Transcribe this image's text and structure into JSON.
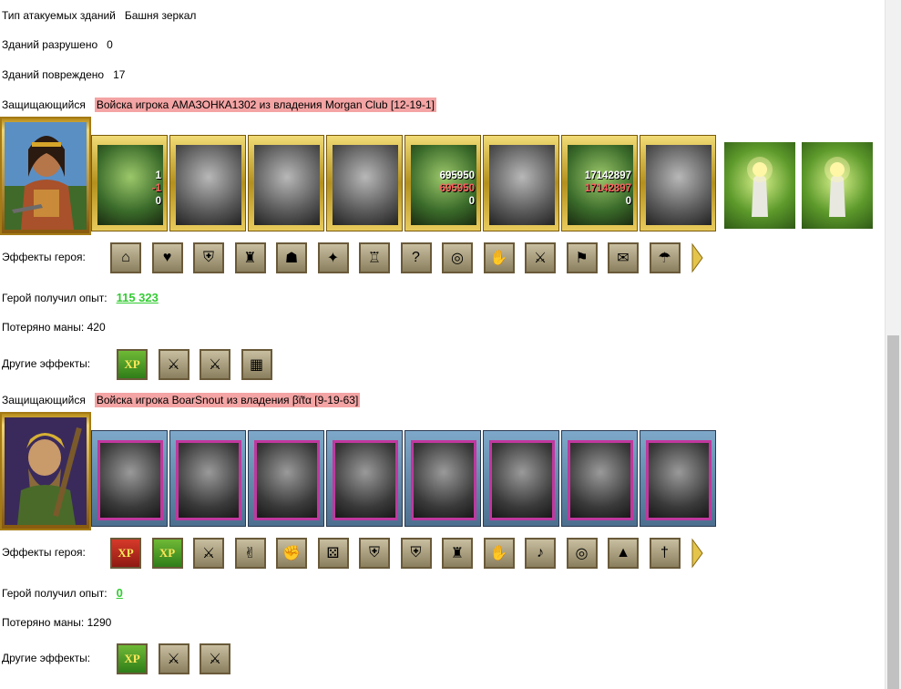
{
  "stats": {
    "building_type_label": "Тип атакуемых зданий",
    "building_type_value": "Башня зеркал",
    "destroyed_label": "Зданий разрушено",
    "destroyed_value": "0",
    "damaged_label": "Зданий повреждено",
    "damaged_value": "17"
  },
  "defender1": {
    "label": "Защищающийся",
    "title": "Войска игрока АМАЗОНКА1302 из владения Morgan Club [12-19-1]",
    "units": [
      {
        "icon": "dwarf-unit-icon",
        "n1": "1",
        "n2": "-1",
        "n3": "0",
        "color": true
      },
      {
        "icon": "dark-knight-unit-icon",
        "color": false
      },
      {
        "icon": "warrior-unit-icon",
        "color": false
      },
      {
        "icon": "griffin-unit-icon",
        "color": false
      },
      {
        "icon": "archer-unit-icon",
        "n1": "695950",
        "n2": "695950",
        "n3": "0",
        "color": true
      },
      {
        "icon": "sorceress-unit-icon",
        "color": false
      },
      {
        "icon": "druid-unit-icon",
        "n1": "17142897",
        "n2": "17142897",
        "n3": "0",
        "color": true
      },
      {
        "icon": "titan-unit-icon",
        "color": false
      }
    ],
    "effects_label": "Эффекты героя:",
    "effects": [
      "house-icon",
      "heart-icon",
      "shield-icon",
      "armor-icon",
      "helmet-icon",
      "amulet-icon",
      "tunic-icon",
      "question-icon",
      "ring-icon",
      "gauntlet-icon",
      "sword-icon",
      "banner-icon",
      "scroll-icon",
      "cloak-icon"
    ],
    "exp_label": "Герой получил опыт:",
    "exp_value": "115 323",
    "mana_label": "Потеряно маны:",
    "mana_value": "420",
    "other_label": "Другие эффекты:",
    "other": [
      "xp-icon",
      "sword-icon",
      "sword-scroll-icon",
      "wall-icon"
    ]
  },
  "defender2": {
    "label": "Защищающийся",
    "title": "Войска игрока BoarSnout из владения βϊ̃τα [9-19-63]",
    "units": [
      {
        "icon": "ghoul-unit-icon"
      },
      {
        "icon": "skeleton-unit-icon"
      },
      {
        "icon": "death-knight-unit-icon"
      },
      {
        "icon": "bone-dragon-unit-icon"
      },
      {
        "icon": "lich-king-unit-icon"
      },
      {
        "icon": "banshee-unit-icon"
      },
      {
        "icon": "reaper-unit-icon"
      },
      {
        "icon": "necromancer-unit-icon"
      }
    ],
    "effects_label": "Эффекты героя:",
    "effects": [
      "xp-icon",
      "group-xp-icon",
      "sword-icon",
      "handshake-icon",
      "fist-icon",
      "dice-icon",
      "shield-icon",
      "handshake-shield-icon",
      "armor-icon",
      "gauntlet-icon",
      "horn-icon",
      "ring-icon",
      "tent-icon",
      "dagger-icon"
    ],
    "exp_label": "Герой получил опыт:",
    "exp_value": "0",
    "mana_label": "Потеряно маны:",
    "mana_value": "1290",
    "other_label": "Другие эффекты:",
    "other": [
      "xp-icon",
      "sword-icon",
      "sword-scroll-icon"
    ]
  }
}
